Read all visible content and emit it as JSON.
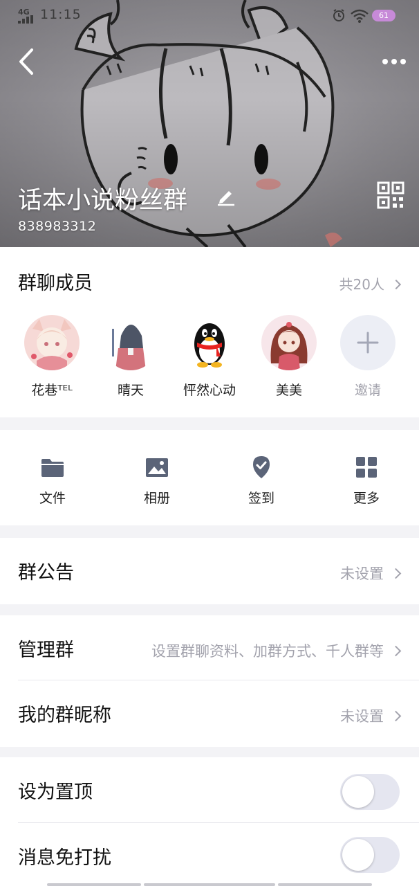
{
  "status_bar": {
    "network": "4G",
    "time": "11:15",
    "battery": "61"
  },
  "header": {
    "group_name": "话本小说粉丝群",
    "group_id": "838983312"
  },
  "members": {
    "title": "群聊成员",
    "count": "共20人",
    "list": [
      {
        "name": "花巷ᵀᴱᴸ",
        "avatar": "anime-girl-cat-avatar"
      },
      {
        "name": "晴天",
        "avatar": "anime-girl-back-avatar"
      },
      {
        "name": "怦然心动",
        "avatar": "qq-penguin-avatar"
      },
      {
        "name": "美美",
        "avatar": "anime-girl-red-hair-avatar"
      }
    ],
    "invite_label": "邀请"
  },
  "tools": [
    {
      "label": "文件",
      "icon": "folder-icon"
    },
    {
      "label": "相册",
      "icon": "photo-icon"
    },
    {
      "label": "签到",
      "icon": "checkin-icon"
    },
    {
      "label": "更多",
      "icon": "grid-icon"
    }
  ],
  "settings": {
    "announcement": {
      "label": "群公告",
      "value": "未设置"
    },
    "manage": {
      "label": "管理群",
      "value": "设置群聊资料、加群方式、千人群等"
    },
    "nickname": {
      "label": "我的群昵称",
      "value": "未设置"
    },
    "pin": {
      "label": "设为置顶",
      "enabled": false
    },
    "mute": {
      "label": "消息免打扰",
      "enabled": false
    }
  },
  "colors": {
    "accent_gray": "#a3a3ad",
    "icon_blue_gray": "#5b6478",
    "battery": "#c78ad8"
  }
}
